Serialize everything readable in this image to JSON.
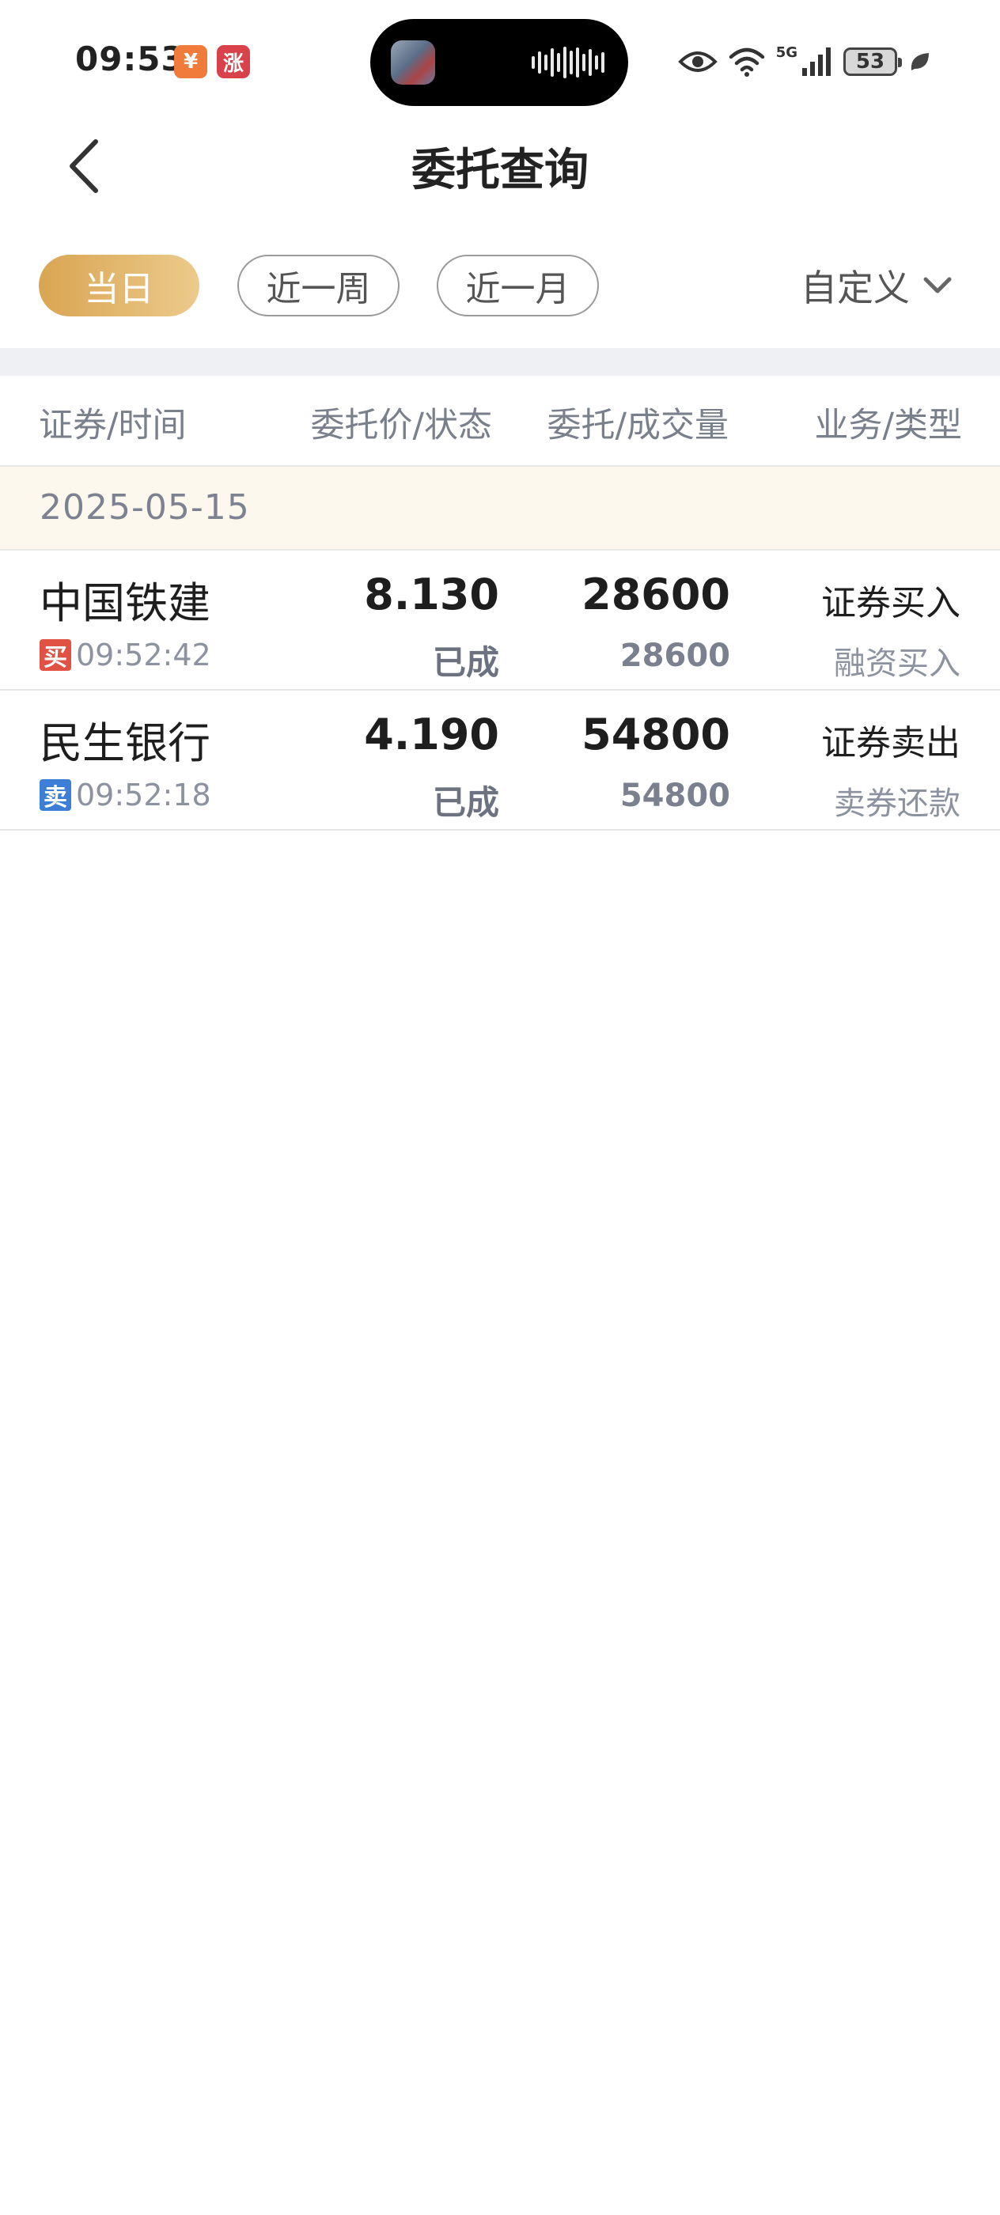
{
  "status_bar": {
    "time": "09:53",
    "app_icon_1": "¥",
    "app_icon_2": "涨",
    "battery": "53",
    "network": "5G"
  },
  "nav": {
    "title": "委托查询"
  },
  "filters": {
    "today": "当日",
    "week": "近一周",
    "month": "近一月",
    "custom": "自定义"
  },
  "table": {
    "headers": [
      "证券/时间",
      "委托价/状态",
      "委托/成交量",
      "业务/类型"
    ],
    "date": "2025-05-15",
    "rows": [
      {
        "name": "中国铁建",
        "side": "买",
        "time": "09:52:42",
        "price": "8.130",
        "status": "已成",
        "qty": "28600",
        "filled": "28600",
        "business": "证券买入",
        "type": "融资买入"
      },
      {
        "name": "民生银行",
        "side": "卖",
        "time": "09:52:18",
        "price": "4.190",
        "status": "已成",
        "qty": "54800",
        "filled": "54800",
        "business": "证券卖出",
        "type": "卖券还款"
      }
    ]
  },
  "colors": {
    "accent_gold": "#d9a552",
    "buy_red": "#e15244",
    "sell_blue": "#3d7fd7",
    "date_bar_bg": "#fdf8ee"
  }
}
